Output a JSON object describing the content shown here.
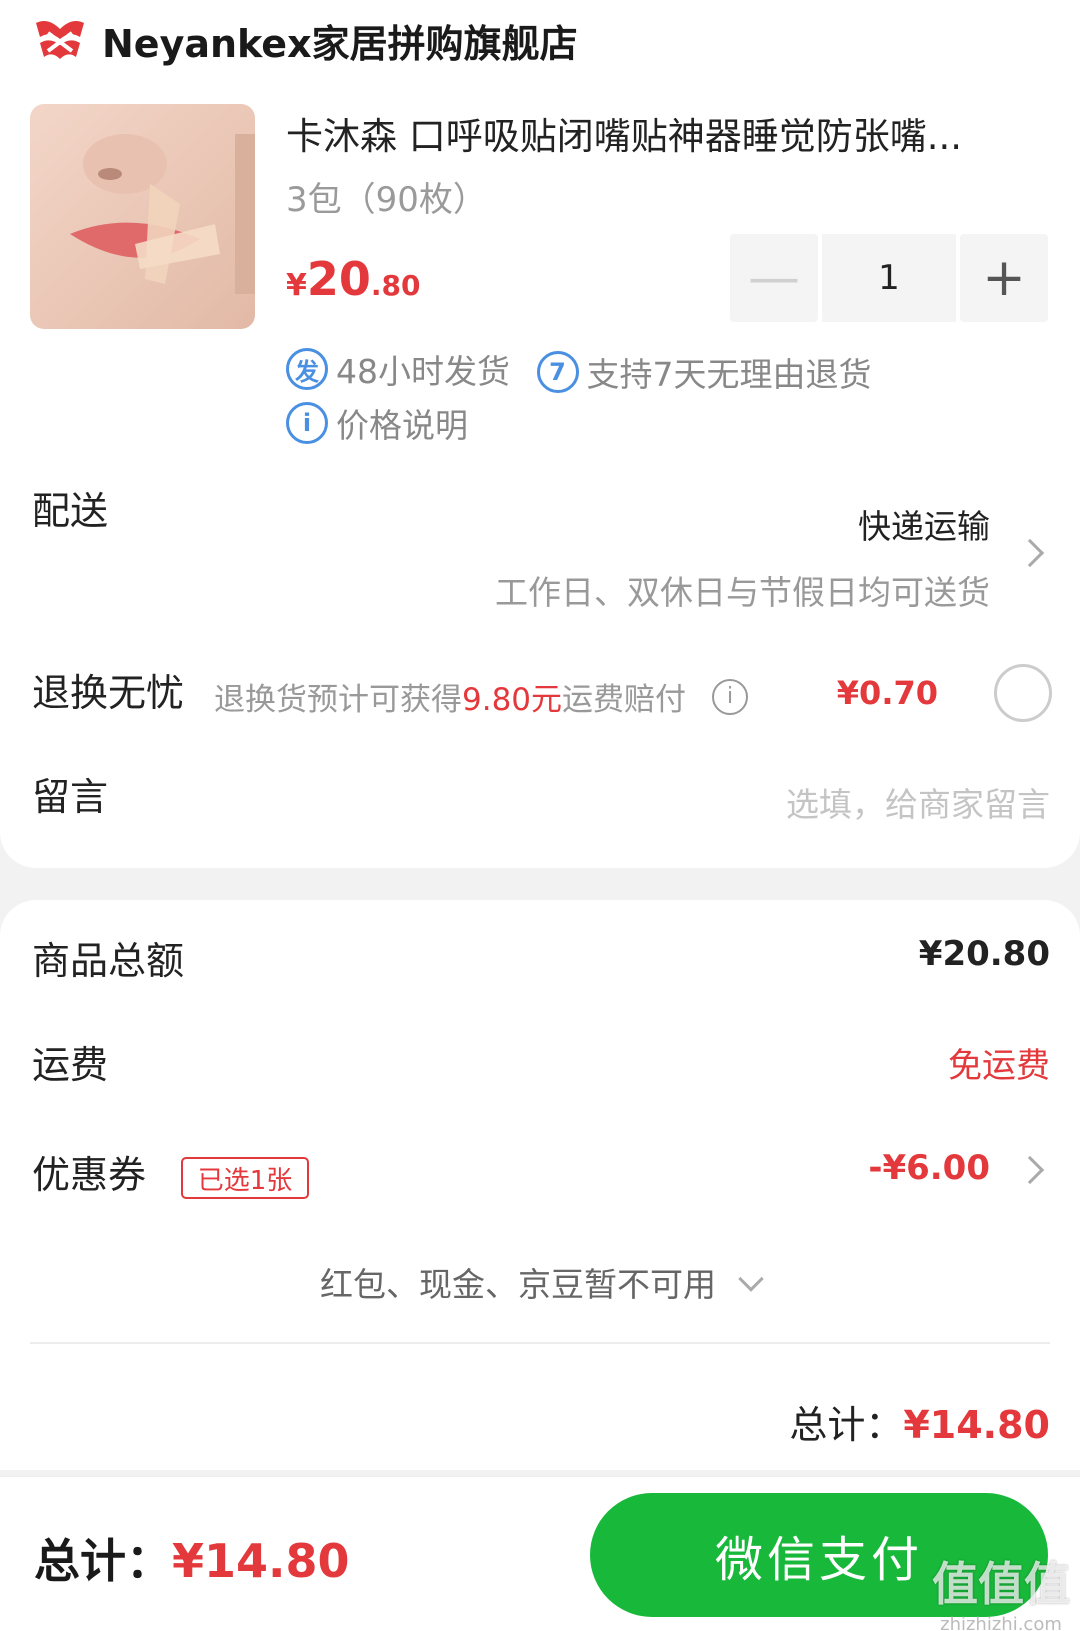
{
  "shop": {
    "name": "Neyankex家居拼购旗舰店",
    "logo_icon": "shop-logo-icon"
  },
  "product": {
    "title": "卡沐森 口呼吸贴闭嘴贴神器睡觉防张嘴...",
    "spec": "3包（90枚）",
    "price_symbol": "¥",
    "price_int": "20",
    "price_dec": ".80",
    "quantity": "1",
    "tags": [
      {
        "icon_text": "发",
        "label": "48小时发货"
      },
      {
        "icon_text": "7",
        "label": "支持7天无理由退货"
      }
    ],
    "price_note_icon": "i",
    "price_note": "价格说明"
  },
  "delivery": {
    "label": "配送",
    "method": "快递运输",
    "note": "工作日、双休日与节假日均可送货"
  },
  "returns": {
    "label": "退换无忧",
    "desc_prefix": "退换货预计可获得",
    "desc_amount": "9.80元",
    "desc_suffix": "运费赔付",
    "info_icon": "i",
    "price": "¥0.70"
  },
  "message": {
    "label": "留言",
    "placeholder": "选填，给商家留言"
  },
  "summary": {
    "goods_label": "商品总额",
    "goods_value": "¥20.80",
    "shipping_label": "运费",
    "shipping_value": "免运费",
    "coupon_label": "优惠券",
    "coupon_badge": "已选1张",
    "coupon_value": "-¥6.00",
    "unavailable": "红包、现金、京豆暂不可用",
    "subtotal_label": "总计：",
    "subtotal_value": "¥14.80"
  },
  "bottom": {
    "total_label": "总计：",
    "total_value": "¥14.80",
    "pay_label": "微信支付"
  },
  "watermark": {
    "big": "值值值",
    "small": "zhizhizhi.com"
  },
  "colors": {
    "accent_red": "#e4393c",
    "pay_green": "#18b83a",
    "tag_blue": "#4a90e2"
  }
}
